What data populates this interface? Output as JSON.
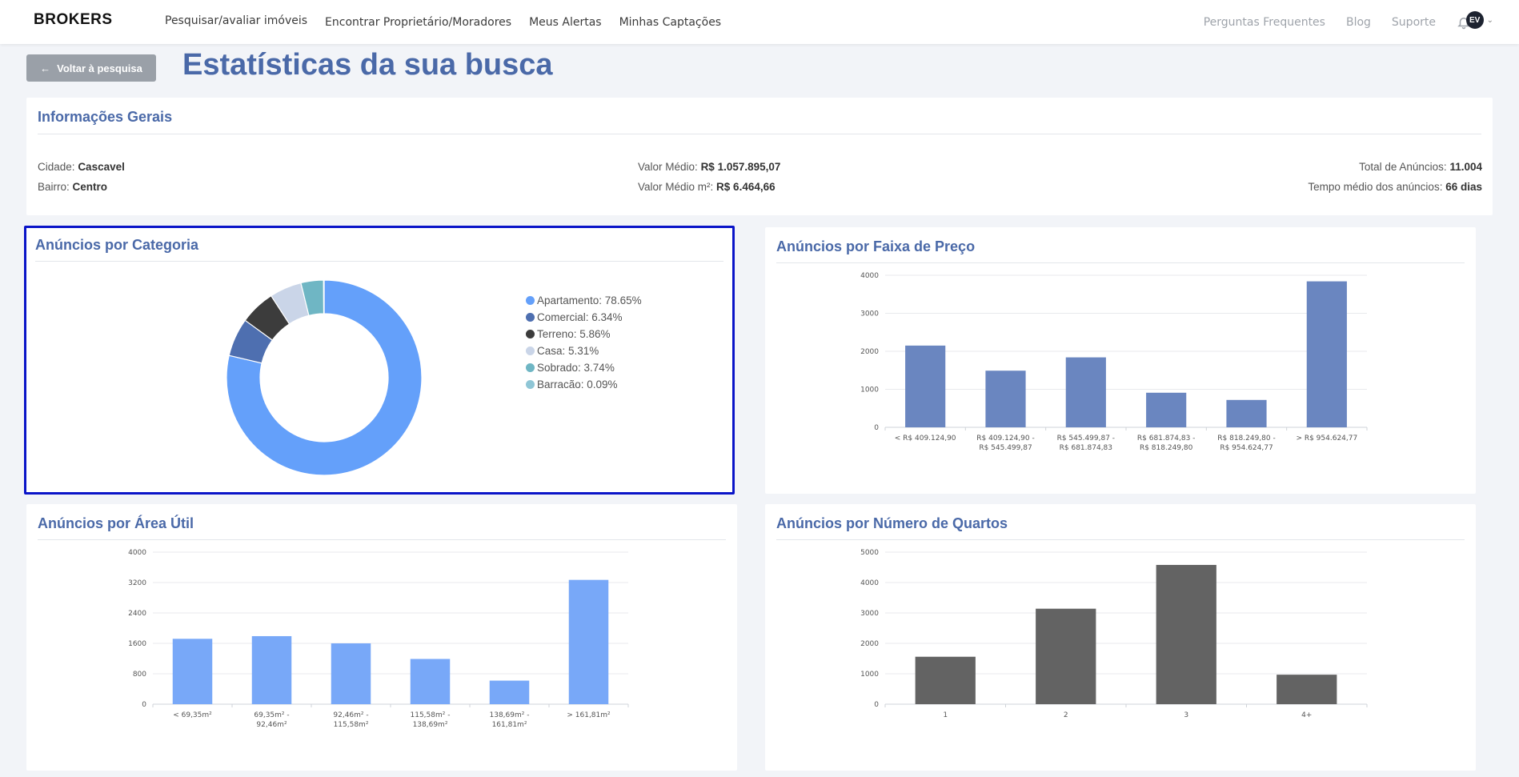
{
  "nav": {
    "logo": "BROKERS",
    "links": [
      "Pesquisar/avaliar imóveis",
      "Encontrar Proprietário/Moradores",
      "Meus Alertas",
      "Minhas Captações"
    ],
    "right_links": [
      "Perguntas Frequentes",
      "Blog",
      "Suporte"
    ],
    "avatar_initials": "EV"
  },
  "header": {
    "back_label": "Voltar à pesquisa",
    "title": "Estatísticas da sua busca"
  },
  "info": {
    "title": "Informações Gerais",
    "cidade_label": "Cidade:",
    "cidade_value": "Cascavel",
    "bairro_label": "Bairro:",
    "bairro_value": "Centro",
    "valor_medio_label": "Valor Médio:",
    "valor_medio_value": "R$ 1.057.895,07",
    "valor_m2_label": "Valor Médio m²:",
    "valor_m2_value": "R$ 6.464,66",
    "total_label": "Total de Anúncios:",
    "total_value": "11.004",
    "tempo_label": "Tempo médio dos anúncios:",
    "tempo_value": "66 dias"
  },
  "colors": {
    "title": "#4a69a8",
    "apartamento": "#64a0fa",
    "comercial": "#4e6fb0",
    "terreno": "#3c3c3c",
    "casa": "#cad5e8",
    "sobrado": "#6fb6c4",
    "barracao": "#8fc6d6",
    "price_bars": "#6a86c0",
    "area_bars": "#78a8f8",
    "rooms_bars": "#636363"
  },
  "chart_data": [
    {
      "id": "categoria",
      "type": "pie",
      "title": "Anúncios por Categoria",
      "labels": [
        "Apartamento",
        "Comercial",
        "Terreno",
        "Casa",
        "Sobrado",
        "Barracão"
      ],
      "values": [
        78.65,
        6.34,
        5.86,
        5.31,
        3.74,
        0.09
      ],
      "legend_text": [
        "Apartamento: 78.65%",
        "Comercial: 6.34%",
        "Terreno: 5.86%",
        "Casa: 5.31%",
        "Sobrado: 3.74%",
        "Barracão: 0.09%"
      ],
      "colors": [
        "#64a0fa",
        "#4e6fb0",
        "#3c3c3c",
        "#cad5e8",
        "#6fb6c4",
        "#8fc6d6"
      ],
      "legend": "right"
    },
    {
      "id": "preco",
      "type": "bar",
      "title": "Anúncios por Faixa de Preço",
      "categories": [
        [
          "< R$ 409.124,90"
        ],
        [
          "R$ 409.124,90 -",
          "R$ 545.499,87"
        ],
        [
          "R$ 545.499,87 -",
          "R$ 681.874,83"
        ],
        [
          "R$ 681.874,83 -",
          "R$ 818.249,80"
        ],
        [
          "R$ 818.249,80 -",
          "R$ 954.624,77"
        ],
        [
          "> R$ 954.624,77"
        ]
      ],
      "values": [
        2150,
        1490,
        1840,
        910,
        720,
        3840
      ],
      "ylim": [
        0,
        4000
      ],
      "yticks": [
        0,
        1000,
        2000,
        3000,
        4000
      ],
      "color": "#6a86c0",
      "grid": true
    },
    {
      "id": "area",
      "type": "bar",
      "title": "Anúncios por Área Útil",
      "categories": [
        [
          "< 69,35m²"
        ],
        [
          "69,35m² -",
          "92,46m²"
        ],
        [
          "92,46m² -",
          "115,58m²"
        ],
        [
          "115,58m² -",
          "138,69m²"
        ],
        [
          "138,69m² -",
          "161,81m²"
        ],
        [
          "> 161,81m²"
        ]
      ],
      "values": [
        1720,
        1790,
        1600,
        1190,
        620,
        3270
      ],
      "ylim": [
        0,
        4000
      ],
      "yticks": [
        0,
        800,
        1600,
        2400,
        3200,
        4000
      ],
      "color": "#78a8f8",
      "grid": true
    },
    {
      "id": "quartos",
      "type": "bar",
      "title": "Anúncios por Número de Quartos",
      "categories": [
        [
          "1"
        ],
        [
          "2"
        ],
        [
          "3"
        ],
        [
          "4+"
        ]
      ],
      "values": [
        1560,
        3140,
        4580,
        970
      ],
      "ylim": [
        0,
        5000
      ],
      "yticks": [
        0,
        1000,
        2000,
        3000,
        4000,
        5000
      ],
      "color": "#636363",
      "grid": true
    }
  ]
}
